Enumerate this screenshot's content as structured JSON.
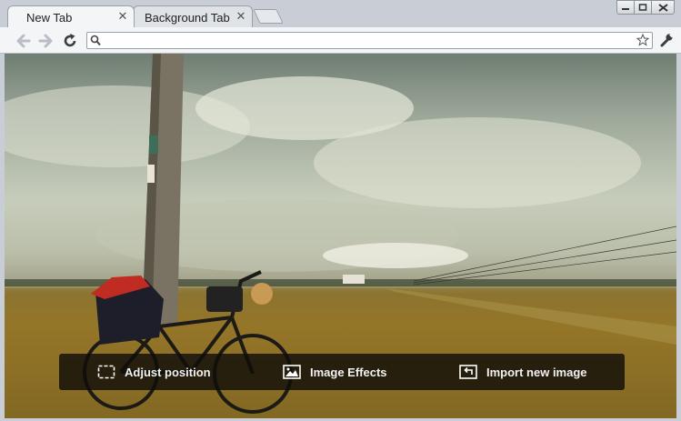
{
  "tabs": [
    {
      "label": "New Tab",
      "active": true
    },
    {
      "label": "Background Tab",
      "active": false
    }
  ],
  "omnibox": {
    "value": "",
    "placeholder": ""
  },
  "icons": {
    "back": "back-arrow-icon",
    "forward": "forward-arrow-icon",
    "reload": "reload-icon",
    "search": "search-icon",
    "star": "star-icon",
    "wrench": "wrench-icon"
  },
  "overlay": {
    "adjust_label": "Adjust position",
    "effects_label": "Image Effects",
    "import_label": "Import new image"
  }
}
